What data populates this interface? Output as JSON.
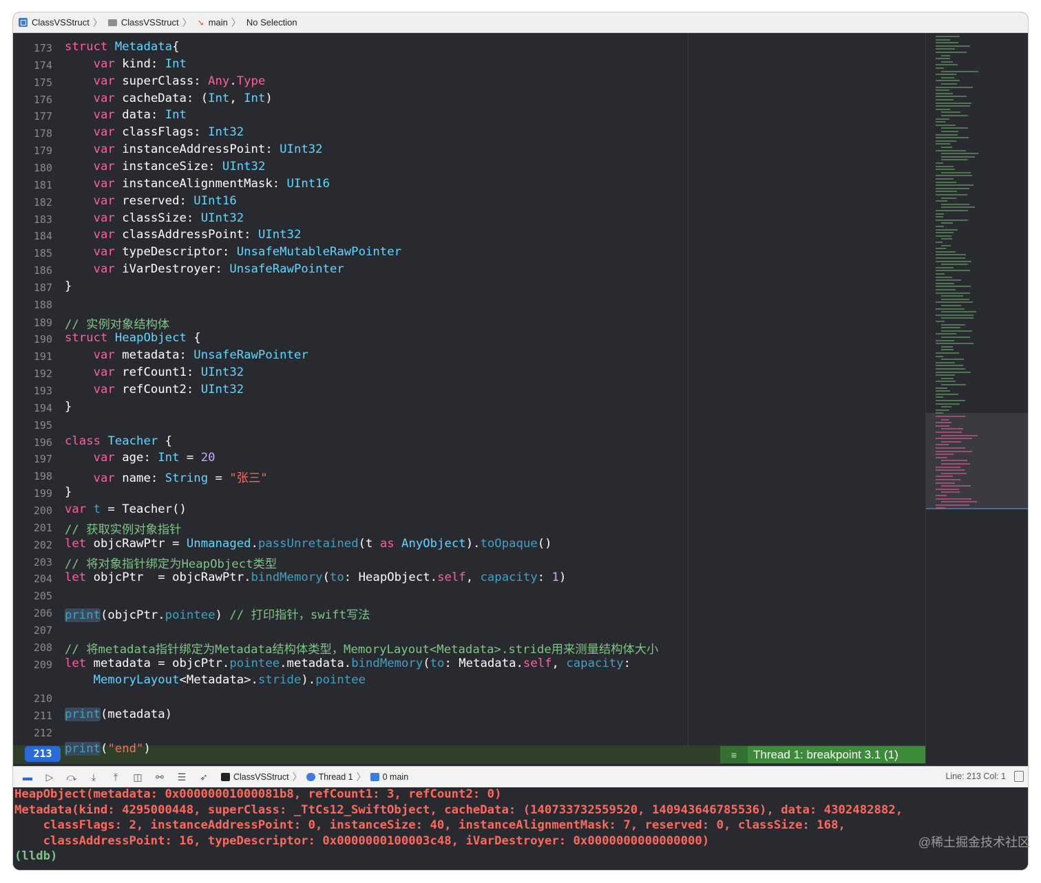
{
  "jumpbar": {
    "items": [
      "ClassVSStruct",
      "ClassVSStruct",
      "main",
      "No Selection"
    ]
  },
  "editor": {
    "current_line": "213",
    "breakpoint_banner": "Thread 1: breakpoint 3.1 (1)",
    "lines": [
      {
        "n": "173",
        "segs": [
          [
            "kw",
            "struct "
          ],
          [
            "ty",
            "Metadata"
          ],
          [
            "p",
            "{"
          ]
        ]
      },
      {
        "n": "174",
        "segs": [
          [
            "p",
            "    "
          ],
          [
            "kw",
            "var "
          ],
          [
            "p",
            "kind: "
          ],
          [
            "ty",
            "Int"
          ]
        ]
      },
      {
        "n": "175",
        "segs": [
          [
            "p",
            "    "
          ],
          [
            "kw",
            "var "
          ],
          [
            "p",
            "superClass: "
          ],
          [
            "kw",
            "Any"
          ],
          [
            "p",
            "."
          ],
          [
            "kw",
            "Type"
          ]
        ]
      },
      {
        "n": "176",
        "segs": [
          [
            "p",
            "    "
          ],
          [
            "kw",
            "var "
          ],
          [
            "p",
            "cacheData: ("
          ],
          [
            "ty",
            "Int"
          ],
          [
            "p",
            ", "
          ],
          [
            "ty",
            "Int"
          ],
          [
            "p",
            ")"
          ]
        ]
      },
      {
        "n": "177",
        "segs": [
          [
            "p",
            "    "
          ],
          [
            "kw",
            "var "
          ],
          [
            "p",
            "data: "
          ],
          [
            "ty",
            "Int"
          ]
        ]
      },
      {
        "n": "178",
        "segs": [
          [
            "p",
            "    "
          ],
          [
            "kw",
            "var "
          ],
          [
            "p",
            "classFlags: "
          ],
          [
            "ty",
            "Int32"
          ]
        ]
      },
      {
        "n": "179",
        "segs": [
          [
            "p",
            "    "
          ],
          [
            "kw",
            "var "
          ],
          [
            "p",
            "instanceAddressPoint: "
          ],
          [
            "ty",
            "UInt32"
          ]
        ]
      },
      {
        "n": "180",
        "segs": [
          [
            "p",
            "    "
          ],
          [
            "kw",
            "var "
          ],
          [
            "p",
            "instanceSize: "
          ],
          [
            "ty",
            "UInt32"
          ]
        ]
      },
      {
        "n": "181",
        "segs": [
          [
            "p",
            "    "
          ],
          [
            "kw",
            "var "
          ],
          [
            "p",
            "instanceAlignmentMask: "
          ],
          [
            "ty",
            "UInt16"
          ]
        ]
      },
      {
        "n": "182",
        "segs": [
          [
            "p",
            "    "
          ],
          [
            "kw",
            "var "
          ],
          [
            "p",
            "reserved: "
          ],
          [
            "ty",
            "UInt16"
          ]
        ]
      },
      {
        "n": "183",
        "segs": [
          [
            "p",
            "    "
          ],
          [
            "kw",
            "var "
          ],
          [
            "p",
            "classSize: "
          ],
          [
            "ty",
            "UInt32"
          ]
        ]
      },
      {
        "n": "184",
        "segs": [
          [
            "p",
            "    "
          ],
          [
            "kw",
            "var "
          ],
          [
            "p",
            "classAddressPoint: "
          ],
          [
            "ty",
            "UInt32"
          ]
        ]
      },
      {
        "n": "185",
        "segs": [
          [
            "p",
            "    "
          ],
          [
            "kw",
            "var "
          ],
          [
            "p",
            "typeDescriptor: "
          ],
          [
            "ty",
            "UnsafeMutableRawPointer"
          ]
        ]
      },
      {
        "n": "186",
        "segs": [
          [
            "p",
            "    "
          ],
          [
            "kw",
            "var "
          ],
          [
            "p",
            "iVarDestroyer: "
          ],
          [
            "ty",
            "UnsafeRawPointer"
          ]
        ]
      },
      {
        "n": "187",
        "segs": [
          [
            "p",
            "}"
          ]
        ]
      },
      {
        "n": "188",
        "segs": []
      },
      {
        "n": "189",
        "segs": [
          [
            "cmz",
            "// 实例对象结构体"
          ]
        ]
      },
      {
        "n": "190",
        "segs": [
          [
            "kw",
            "struct "
          ],
          [
            "ty",
            "HeapObject"
          ],
          [
            "p",
            " {"
          ]
        ]
      },
      {
        "n": "191",
        "segs": [
          [
            "p",
            "    "
          ],
          [
            "kw",
            "var "
          ],
          [
            "p",
            "metadata: "
          ],
          [
            "ty",
            "UnsafeRawPointer"
          ]
        ]
      },
      {
        "n": "192",
        "segs": [
          [
            "p",
            "    "
          ],
          [
            "kw",
            "var "
          ],
          [
            "p",
            "refCount1: "
          ],
          [
            "ty",
            "UInt32"
          ]
        ]
      },
      {
        "n": "193",
        "segs": [
          [
            "p",
            "    "
          ],
          [
            "kw",
            "var "
          ],
          [
            "p",
            "refCount2: "
          ],
          [
            "ty",
            "UInt32"
          ]
        ]
      },
      {
        "n": "194",
        "segs": [
          [
            "p",
            "}"
          ]
        ]
      },
      {
        "n": "195",
        "segs": []
      },
      {
        "n": "196",
        "segs": [
          [
            "kw",
            "class "
          ],
          [
            "ty",
            "Teacher"
          ],
          [
            "p",
            " {"
          ]
        ]
      },
      {
        "n": "197",
        "segs": [
          [
            "p",
            "    "
          ],
          [
            "kw",
            "var "
          ],
          [
            "p",
            "age: "
          ],
          [
            "ty",
            "Int"
          ],
          [
            "p",
            " = "
          ],
          [
            "tn",
            "20"
          ]
        ]
      },
      {
        "n": "198",
        "segs": [
          [
            "p",
            "    "
          ],
          [
            "kw",
            "var "
          ],
          [
            "p",
            "name: "
          ],
          [
            "ty",
            "String"
          ],
          [
            "p",
            " = "
          ],
          [
            "str",
            "\"张三\""
          ]
        ]
      },
      {
        "n": "199",
        "segs": [
          [
            "p",
            "}"
          ]
        ]
      },
      {
        "n": "200",
        "segs": [
          [
            "kw",
            "var "
          ],
          [
            "pm",
            "t"
          ],
          [
            "p",
            " = Teacher()"
          ]
        ]
      },
      {
        "n": "201",
        "segs": [
          [
            "cmz",
            "// 获取实例对象指针"
          ]
        ]
      },
      {
        "n": "202",
        "segs": [
          [
            "kw",
            "let "
          ],
          [
            "p",
            "objcRawPtr = "
          ],
          [
            "ty",
            "Unmanaged"
          ],
          [
            "p",
            "."
          ],
          [
            "pm",
            "passUnretained"
          ],
          [
            "p",
            "(t "
          ],
          [
            "kw",
            "as "
          ],
          [
            "ty",
            "AnyObject"
          ],
          [
            "p",
            ")."
          ],
          [
            "pm",
            "toOpaque"
          ],
          [
            "p",
            "()"
          ]
        ]
      },
      {
        "n": "203",
        "segs": [
          [
            "cmz",
            "// 将对象指针绑定为HeapObject类型"
          ]
        ]
      },
      {
        "n": "204",
        "segs": [
          [
            "kw",
            "let "
          ],
          [
            "p",
            "objcPtr  = objcRawPtr."
          ],
          [
            "pm",
            "bindMemory"
          ],
          [
            "p",
            "("
          ],
          [
            "pm",
            "to"
          ],
          [
            "p",
            ": HeapObject."
          ],
          [
            "kw",
            "self"
          ],
          [
            "p",
            ", "
          ],
          [
            "pm",
            "capacity"
          ],
          [
            "p",
            ": "
          ],
          [
            "tn",
            "1"
          ],
          [
            "p",
            ")"
          ]
        ]
      },
      {
        "n": "205",
        "segs": []
      },
      {
        "n": "206",
        "segs": [
          [
            "hl",
            "print"
          ],
          [
            "p",
            "(objcPtr."
          ],
          [
            "pm",
            "pointee"
          ],
          [
            "p",
            ") "
          ],
          [
            "cmz",
            "// 打印指针，swift写法"
          ]
        ]
      },
      {
        "n": "207",
        "segs": []
      },
      {
        "n": "208",
        "segs": [
          [
            "cmz",
            "// 将metadata指针绑定为Metadata结构体类型，MemoryLayout<Metadata>.stride用来测量结构体大小"
          ]
        ]
      },
      {
        "n": "209",
        "segs": [
          [
            "kw",
            "let "
          ],
          [
            "p",
            "metadata = objcPtr."
          ],
          [
            "pm",
            "pointee"
          ],
          [
            "p",
            ".metadata."
          ],
          [
            "pm",
            "bindMemory"
          ],
          [
            "p",
            "("
          ],
          [
            "pm",
            "to"
          ],
          [
            "p",
            ": Metadata."
          ],
          [
            "kw",
            "self"
          ],
          [
            "p",
            ", "
          ],
          [
            "pm",
            "capacity"
          ],
          [
            "p",
            ":"
          ]
        ]
      },
      {
        "n": "",
        "segs": [
          [
            "p",
            "    "
          ],
          [
            "ty",
            "MemoryLayout"
          ],
          [
            "p",
            "<Metadata>."
          ],
          [
            "pm",
            "stride"
          ],
          [
            "p",
            ")."
          ],
          [
            "pm",
            "pointee"
          ]
        ]
      },
      {
        "n": "210",
        "segs": []
      },
      {
        "n": "211",
        "segs": [
          [
            "hl",
            "print"
          ],
          [
            "p",
            "(metadata)"
          ]
        ]
      },
      {
        "n": "212",
        "segs": []
      },
      {
        "n": "213",
        "segs": [
          [
            "hl",
            "print"
          ],
          [
            "p",
            "("
          ],
          [
            "str",
            "\"end\""
          ],
          [
            "p",
            ")"
          ]
        ]
      }
    ]
  },
  "debugbar": {
    "crumbs": [
      "ClassVSStruct",
      "Thread 1",
      "0 main"
    ],
    "line_info": "Line: 213  Col: 1"
  },
  "console": {
    "lines": [
      "HeapObject(metadata: 0x00000001000081b8, refCount1: 3, refCount2: 0)",
      "Metadata(kind: 4295000448, superClass: _TtCs12_SwiftObject, cacheData: (140733732559520, 140943646785536), data: 4302482882,",
      "    classFlags: 2, instanceAddressPoint: 0, instanceSize: 40, instanceAlignmentMask: 7, reserved: 0, classSize: 168,",
      "    classAddressPoint: 16, typeDescriptor: 0x0000000100003c48, iVarDestroyer: 0x0000000000000000)",
      "(lldb)"
    ],
    "watermark": "@稀土掘金技术社区"
  }
}
